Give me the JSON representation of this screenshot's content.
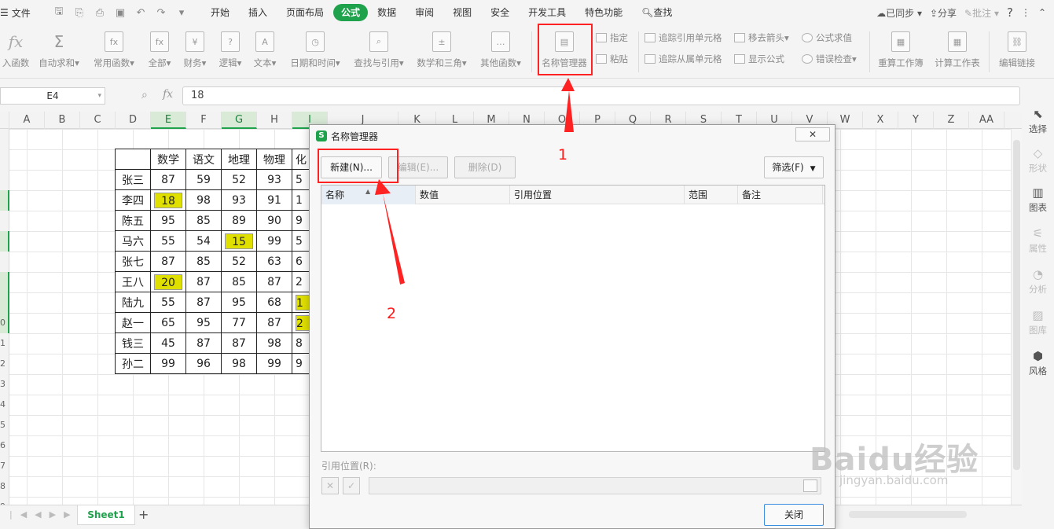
{
  "menubar": {
    "file_label": "文件",
    "tabs": [
      "开始",
      "插入",
      "页面布局",
      "公式",
      "数据",
      "审阅",
      "视图",
      "安全",
      "开发工具",
      "特色功能"
    ],
    "active_tab": "公式",
    "search_label": "查找",
    "sync_label": "已同步",
    "share_label": "分享",
    "comment_label": "批注",
    "help_label": "?"
  },
  "ribbon": {
    "insert_fn": "入函数",
    "autosum": "自动求和",
    "common_fn": "常用函数",
    "all": "全部",
    "finance": "财务",
    "logic": "逻辑",
    "text": "文本",
    "datetime": "日期和时间",
    "lookup": "查找与引用",
    "math": "数学和三角",
    "other_fn": "其他函数",
    "name_manager": "名称管理器",
    "specify": "指定",
    "paste": "粘贴",
    "trace_precedents": "追踪引用单元格",
    "trace_dependents": "追踪从属单元格",
    "remove_arrows": "移去箭头",
    "show_formulas": "显示公式",
    "evaluate": "公式求值",
    "error_check": "错误检查",
    "recalc_book": "重算工作簿",
    "calc_sheet": "计算工作表",
    "edit_links": "编辑链接"
  },
  "formula_bar": {
    "cell_ref": "E4",
    "value": "18"
  },
  "grid": {
    "columns": [
      "A",
      "B",
      "C",
      "D",
      "E",
      "F",
      "G",
      "H",
      "I",
      "J",
      "K",
      "L",
      "M",
      "N",
      "O",
      "P",
      "Q",
      "R",
      "S",
      "T",
      "U",
      "V",
      "W",
      "X",
      "Y",
      "Z",
      "AA"
    ],
    "rows": [
      "",
      "",
      "",
      "",
      "",
      "",
      "",
      "",
      "",
      "0",
      "1",
      "2",
      "3",
      "4",
      "5",
      "6",
      "7",
      "8",
      "9"
    ],
    "table_header": [
      "",
      "数学",
      "语文",
      "地理",
      "物理",
      "化"
    ],
    "table_rows": [
      {
        "name": "张三",
        "cells": [
          "87",
          "59",
          "52",
          "93",
          "5"
        ],
        "hl": [
          false,
          false,
          false,
          false,
          false
        ]
      },
      {
        "name": "李四",
        "cells": [
          "18",
          "98",
          "93",
          "91",
          "1"
        ],
        "hl": [
          true,
          false,
          false,
          false,
          false
        ]
      },
      {
        "name": "陈五",
        "cells": [
          "95",
          "85",
          "89",
          "90",
          "9"
        ],
        "hl": [
          false,
          false,
          false,
          false,
          false
        ]
      },
      {
        "name": "马六",
        "cells": [
          "55",
          "54",
          "15",
          "99",
          "5"
        ],
        "hl": [
          false,
          false,
          true,
          false,
          false
        ]
      },
      {
        "name": "张七",
        "cells": [
          "87",
          "85",
          "52",
          "63",
          "6"
        ],
        "hl": [
          false,
          false,
          false,
          false,
          false
        ]
      },
      {
        "name": "王八",
        "cells": [
          "20",
          "87",
          "85",
          "87",
          "2"
        ],
        "hl": [
          true,
          false,
          false,
          false,
          false
        ]
      },
      {
        "name": "陆九",
        "cells": [
          "55",
          "87",
          "95",
          "68",
          "1"
        ],
        "hl": [
          false,
          false,
          false,
          false,
          true
        ]
      },
      {
        "name": "赵一",
        "cells": [
          "65",
          "95",
          "77",
          "87",
          "2"
        ],
        "hl": [
          false,
          false,
          false,
          false,
          true
        ]
      },
      {
        "name": "钱三",
        "cells": [
          "45",
          "87",
          "87",
          "98",
          "8"
        ],
        "hl": [
          false,
          false,
          false,
          false,
          false
        ]
      },
      {
        "name": "孙二",
        "cells": [
          "99",
          "96",
          "98",
          "99",
          "9"
        ],
        "hl": [
          false,
          false,
          false,
          false,
          false
        ]
      }
    ]
  },
  "sidebar": {
    "select": "选择",
    "shape": "形状",
    "chart": "图表",
    "property": "属性",
    "analysis": "分析",
    "gallery": "图库",
    "style": "风格"
  },
  "sheet": {
    "tab_name": "Sheet1",
    "add": "+"
  },
  "dialog": {
    "title": "名称管理器",
    "new_btn": "新建(N)...",
    "edit_btn": "编辑(E)...",
    "delete_btn": "删除(D)",
    "filter_btn": "筛选(F)",
    "col_name": "名称",
    "col_value": "数值",
    "col_ref": "引用位置",
    "col_scope": "范围",
    "col_note": "备注",
    "ref_label": "引用位置(R):",
    "close_btn": "关闭"
  },
  "annotations": {
    "marker1": "1",
    "marker2": "2",
    "color": "#ff2222"
  },
  "watermark": {
    "logo": "Baidu经验",
    "url": "jingyan.baidu.com"
  }
}
